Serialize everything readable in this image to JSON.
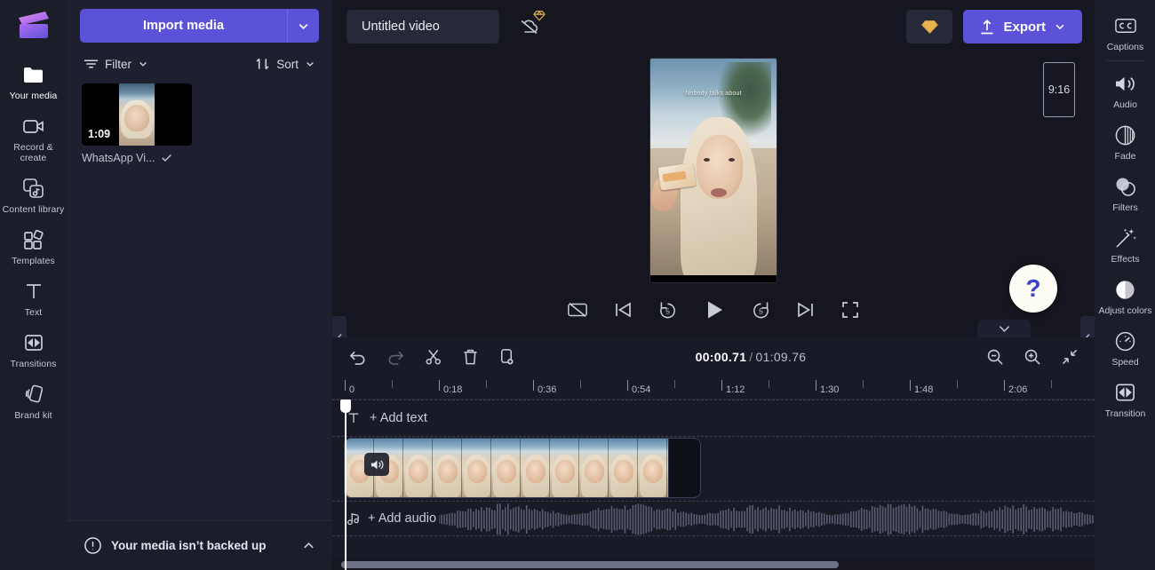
{
  "brand": {
    "accent": "#5b52d9",
    "app_background": "#15161f",
    "panel_background": "#1e2030",
    "rail_background": "#1b1d29"
  },
  "left_rail": {
    "logo_name": "clipchamp-logo",
    "items": [
      {
        "label": "Your media",
        "icon": "folder-icon",
        "active": true
      },
      {
        "label": "Record & create",
        "icon": "video-camera-icon",
        "active": false
      },
      {
        "label": "Content library",
        "icon": "content-library-icon",
        "active": false
      },
      {
        "label": "Templates",
        "icon": "templates-icon",
        "active": false
      },
      {
        "label": "Text",
        "icon": "text-icon",
        "active": false
      },
      {
        "label": "Transitions",
        "icon": "transitions-icon",
        "active": false
      },
      {
        "label": "Brand kit",
        "icon": "brand-kit-icon",
        "active": false
      }
    ]
  },
  "media_panel": {
    "import_label": "Import media",
    "import_caret_icon": "chevron-down-icon",
    "filter_label": "Filter",
    "filter_icon": "filter-icon",
    "sort_label": "Sort",
    "sort_icon": "sort-arrows-icon",
    "items": [
      {
        "name": "WhatsApp Vi...",
        "duration": "1:09",
        "selected_icon": "check-icon"
      }
    ],
    "backup_notice": "Your media isn’t backed up",
    "backup_icon": "alert-circle-icon",
    "backup_collapse_icon": "chevron-up-icon"
  },
  "topbar": {
    "project_title": "Untitled video",
    "project_title_placeholder": "Untitled video",
    "cloud_icon": "cloud-off-icon",
    "cloud_badge_icon": "diamond-premium-icon",
    "premium_icon": "diamond-premium-icon",
    "export_label": "Export",
    "export_icon": "upload-icon",
    "export_caret_icon": "chevron-down-icon"
  },
  "preview": {
    "aspect_ratio": "9:16",
    "overlay_text": "Nobody talks about",
    "help_label": "?",
    "collapse_left_icon": "chevron-left-icon",
    "collapse_right_icon": "chevron-left-icon",
    "panel_toggle_icon": "chevron-down-icon",
    "controls": [
      {
        "name": "captions-toggle",
        "icon": "captions-off-icon"
      },
      {
        "name": "previous-frame",
        "icon": "skip-back-icon"
      },
      {
        "name": "rewind-5-seconds",
        "icon": "rewind-5-icon"
      },
      {
        "name": "play",
        "icon": "play-icon"
      },
      {
        "name": "forward-5-seconds",
        "icon": "forward-5-icon"
      },
      {
        "name": "next-frame",
        "icon": "skip-forward-icon"
      },
      {
        "name": "fullscreen",
        "icon": "fullscreen-icon"
      }
    ]
  },
  "timeline": {
    "toolbar": [
      {
        "name": "undo",
        "icon": "undo-icon",
        "enabled": true
      },
      {
        "name": "redo",
        "icon": "redo-icon",
        "enabled": false
      },
      {
        "name": "split",
        "icon": "scissors-icon",
        "enabled": true
      },
      {
        "name": "delete",
        "icon": "trash-icon",
        "enabled": true
      },
      {
        "name": "duplicate",
        "icon": "duplicate-icon",
        "enabled": true
      }
    ],
    "current_time": "00:00.71",
    "time_separator": "/",
    "total_time": "01:09.76",
    "zoom_out_icon": "zoom-out-icon",
    "zoom_in_icon": "zoom-in-icon",
    "fit_icon": "fit-to-screen-icon",
    "ruler_labels": [
      "0",
      "0:18",
      "0:36",
      "0:54",
      "1:12",
      "1:30",
      "1:48",
      "2:06"
    ],
    "add_text_label": "+ Add text",
    "add_text_icon": "text-icon",
    "add_audio_label": "+ Add audio",
    "add_audio_icon": "music-note-icon",
    "clip_mute_icon": "speaker-icon"
  },
  "right_rail": {
    "items": [
      {
        "label": "Captions",
        "icon": "cc-icon",
        "divider_after": true
      },
      {
        "label": "Audio",
        "icon": "speaker-icon",
        "divider_after": false
      },
      {
        "label": "Fade",
        "icon": "fade-circle-icon",
        "divider_after": false
      },
      {
        "label": "Filters",
        "icon": "filters-circles-icon",
        "divider_after": false
      },
      {
        "label": "Effects",
        "icon": "magic-wand-icon",
        "divider_after": false
      },
      {
        "label": "Adjust colors",
        "icon": "contrast-circle-icon",
        "divider_after": false
      },
      {
        "label": "Speed",
        "icon": "speedometer-icon",
        "divider_after": false
      },
      {
        "label": "Transition",
        "icon": "transitions-icon",
        "divider_after": false
      }
    ]
  }
}
